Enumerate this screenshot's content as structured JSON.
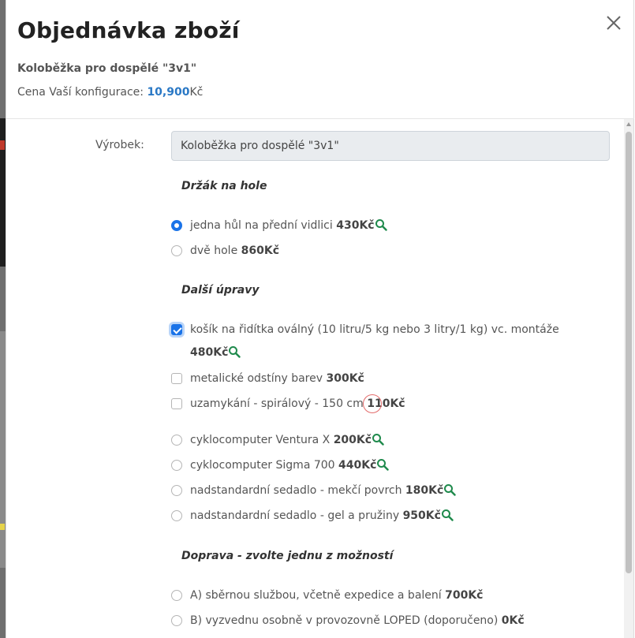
{
  "modal": {
    "title": "Objednávka zboží",
    "product_name": "Koloběžka pro dospělé \"3v1\"",
    "price_prefix": "Cena Vaší konfigurace: ",
    "price_value": "10,900",
    "price_currency": "Kč",
    "close_icon": "close-icon"
  },
  "form": {
    "product_label": "Výrobek:",
    "product_value": "Koloběžka pro dospělé \"3v1\"",
    "sections": {
      "holder": {
        "title": "Držák na hole",
        "options": [
          {
            "text": "jedna hůl na přední vidlici ",
            "price": "430Kč",
            "checked": true,
            "zoom": true
          },
          {
            "text": "dvě hole ",
            "price": "860Kč",
            "checked": false,
            "zoom": false
          }
        ]
      },
      "extras": {
        "title": "Další úpravy",
        "options": [
          {
            "text": "košík na řidítka oválný (10 litru/5 kg nebo 3 litry/1 kg) vc. montáže",
            "price": "480Kč",
            "checked": true,
            "zoom": true
          },
          {
            "text": "metalické odstíny barev ",
            "price": "300Kč",
            "checked": false
          },
          {
            "text": "uzamykání - spirálový - 150 cm ",
            "price": "110Kč",
            "checked": false
          },
          {
            "text": "cyklocomputer Ventura X ",
            "price": "200Kč",
            "checked": false,
            "zoom": true
          },
          {
            "text": "cyklocomputer Sigma 700 ",
            "price": "440Kč",
            "checked": false,
            "zoom": true
          },
          {
            "text": "nadstandardní sedadlo - mekčí povrch ",
            "price": "180Kč",
            "checked": false,
            "zoom": true
          },
          {
            "text": "nadstandardní sedadlo - gel a pružiny ",
            "price": "950Kč",
            "checked": false,
            "zoom": true
          }
        ]
      },
      "delivery": {
        "title": "Doprava - zvolte jednu z možností",
        "options": [
          {
            "text": "A) sběrnou službou, včetně expedice a balení ",
            "price": "700Kč",
            "checked": false
          },
          {
            "text": "B) vyzvednu osobně v provozovně LOPED (doporučeno) ",
            "price": "0Kč",
            "checked": false
          }
        ]
      }
    }
  },
  "colors": {
    "accent": "#1a73e8",
    "price_blue": "#2a78c5",
    "zoom_green": "#1f8a4c"
  },
  "icons": {
    "zoom": "magnifier-icon",
    "close": "close-icon"
  }
}
